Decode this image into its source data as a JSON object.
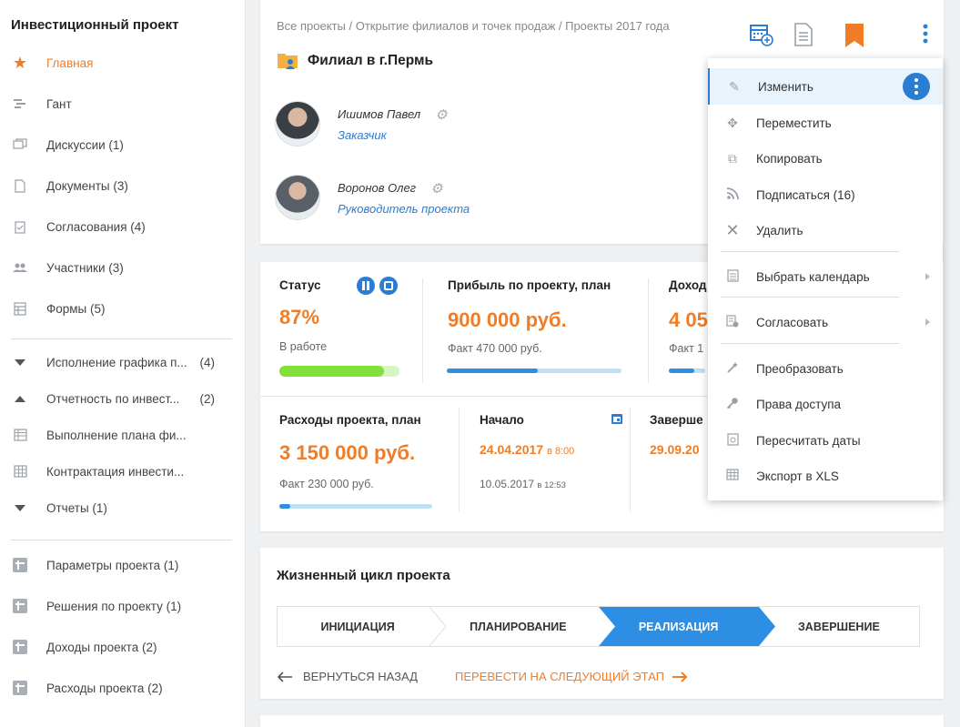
{
  "sidebar": {
    "title": "Инвестиционный проект",
    "items": [
      {
        "label": "Главная",
        "icon": "star-icon"
      },
      {
        "label": "Гант",
        "icon": "gantt-icon"
      },
      {
        "label": "Дискуссии (1)",
        "icon": "discussion-icon"
      },
      {
        "label": "Документы (3)",
        "icon": "document-icon"
      },
      {
        "label": "Согласования (4)",
        "icon": "approval-icon"
      },
      {
        "label": "Участники (3)",
        "icon": "participants-icon"
      },
      {
        "label": "Формы (5)",
        "icon": "forms-icon"
      }
    ],
    "reports": [
      {
        "label": "Исполнение графика п...",
        "count": "(4)",
        "icon": "triangle-down-icon"
      },
      {
        "label": "Отчетность по инвест...",
        "count": "(2)",
        "icon": "triangle-up-icon"
      },
      {
        "label": "Выполнение плана фи...",
        "count": "",
        "icon": "report-table-icon"
      },
      {
        "label": "Контрактация инвести...",
        "count": "",
        "icon": "grid-icon"
      },
      {
        "label": "Отчеты (1)",
        "count": "",
        "icon": "triangle-down-icon"
      }
    ],
    "params": [
      {
        "label": "Параметры проекта (1)",
        "icon": "plus-box-icon"
      },
      {
        "label": "Решения по проекту (1)",
        "icon": "plus-box-icon"
      },
      {
        "label": "Доходы проекта (2)",
        "icon": "plus-box-icon"
      },
      {
        "label": "Расходы проекта (2)",
        "icon": "plus-box-icon"
      }
    ]
  },
  "header": {
    "breadcrumb": "Все проекты / Открытие филиалов и точек продаж / Проекты 2017 года",
    "project_name": "Филиал в г.Пермь",
    "people": [
      {
        "name": "Ишимов Павел",
        "role": "Заказчик"
      },
      {
        "name": "Воронов Олег",
        "role": "Руководитель проекта"
      }
    ]
  },
  "stats": {
    "status_label": "Статус",
    "status_value": "87%",
    "status_text": "В работе",
    "status_progress": 0.87,
    "profit_label": "Прибыль по проекту, план",
    "profit_value": "900 000 руб.",
    "profit_fact": "Факт  470 000 руб.",
    "profit_progress": 0.52,
    "income_label": "Доход",
    "income_value": "4 05",
    "income_fact": "Факт  1",
    "expenses_label": "Расходы проекта, план",
    "expenses_value": "3 150 000 руб.",
    "expenses_fact": "Факт  230 000 руб.",
    "expenses_progress": 0.07,
    "start_label": "Начало",
    "start_date": "24.04.2017",
    "start_time": "в 8:00",
    "start_fact_date": "10.05.2017",
    "start_fact_time": "в 12:53",
    "end_label": "Заверше",
    "end_date": "29.09.20"
  },
  "lifecycle": {
    "title": "Жизненный цикл проекта",
    "stages": [
      "ИНИЦИАЦИЯ",
      "ПЛАНИРОВАНИЕ",
      "РЕАЛИЗАЦИЯ",
      "ЗАВЕРШЕНИЕ"
    ],
    "active_stage": "РЕАЛИЗАЦИЯ",
    "back_label": "ВЕРНУТЬСЯ НАЗАД",
    "next_label": "ПЕРЕВЕСТИ НА СЛЕДУЮЩИЙ ЭТАП"
  },
  "menu": {
    "items": [
      {
        "label": "Изменить",
        "icon": "pencil-icon"
      },
      {
        "label": "Переместить",
        "icon": "move-icon"
      },
      {
        "label": "Копировать",
        "icon": "copy-icon"
      },
      {
        "label": "Подписаться (16)",
        "icon": "rss-icon"
      },
      {
        "label": "Удалить",
        "icon": "close-icon"
      },
      {
        "label": "Выбрать календарь",
        "icon": "calendar-list-icon"
      },
      {
        "label": "Согласовать",
        "icon": "approve-doc-icon"
      },
      {
        "label": "Преобразовать",
        "icon": "wand-icon"
      },
      {
        "label": "Права доступа",
        "icon": "key-icon"
      },
      {
        "label": "Пересчитать даты",
        "icon": "recalc-icon"
      },
      {
        "label": "Экспорт в XLS",
        "icon": "table-icon"
      }
    ]
  },
  "colors": {
    "accent_orange": "#f07d26",
    "accent_blue": "#2b7cd3",
    "progress_green": "#82e03b"
  }
}
